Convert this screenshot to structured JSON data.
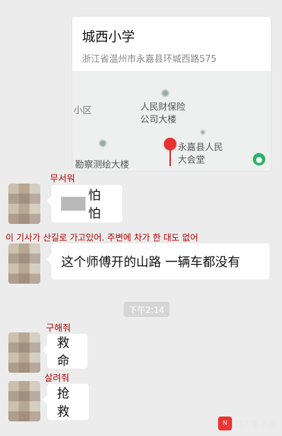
{
  "location": {
    "title": "城西小学",
    "address": "浙江省温州市永嘉县环城西路575",
    "map_labels": [
      "小区",
      "人民财保险\n公司大楼",
      "勘察测绘大楼",
      "永嘉县人民\n大会堂"
    ]
  },
  "messages": [
    {
      "translation": "무서워",
      "text": "怕怕",
      "redacted": true
    },
    {
      "translation": "이 기사가 산길로 가고있어. 주변에 차가 한 대도 없어",
      "text": "这个师傅开的山路 一辆车都没有"
    },
    {
      "translation": "구해줘",
      "text": "救命"
    },
    {
      "translation": "살려줘",
      "text": "抢救"
    }
  ],
  "timestamp": "下午2:14",
  "watermark": {
    "logo": "N",
    "text": "南方都市报"
  },
  "colors": {
    "chat_bg": "#ececec",
    "annotation": "#b60000",
    "pin": "#e8322f"
  }
}
